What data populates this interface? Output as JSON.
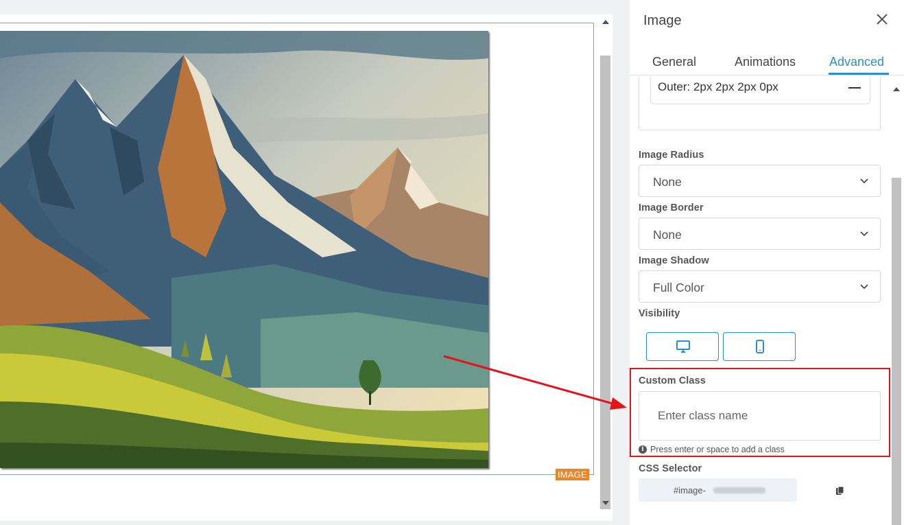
{
  "canvas": {
    "image_tag": "IMAGE"
  },
  "panel": {
    "title": "Image",
    "tabs": [
      {
        "label": "General",
        "active": false
      },
      {
        "label": "Animations",
        "active": false
      },
      {
        "label": "Advanced",
        "active": true
      }
    ],
    "shadow_item": "Outer: 2px 2px 2px 0px",
    "image_radius": {
      "label": "Image Radius",
      "value": "None"
    },
    "image_border": {
      "label": "Image Border",
      "value": "None"
    },
    "image_shadow": {
      "label": "Image Shadow",
      "value": "Full Color"
    },
    "visibility": {
      "label": "Visibility",
      "options": [
        "desktop-icon",
        "mobile-icon"
      ]
    },
    "custom_class": {
      "label": "Custom Class",
      "placeholder": "Enter class name",
      "hint": "Press enter or space to add a class"
    },
    "css_selector": {
      "label": "CSS Selector",
      "value": "#image-"
    }
  },
  "colors": {
    "accent": "#2d8ed8",
    "highlight": "#e4131b",
    "frame": "#e8862a"
  }
}
